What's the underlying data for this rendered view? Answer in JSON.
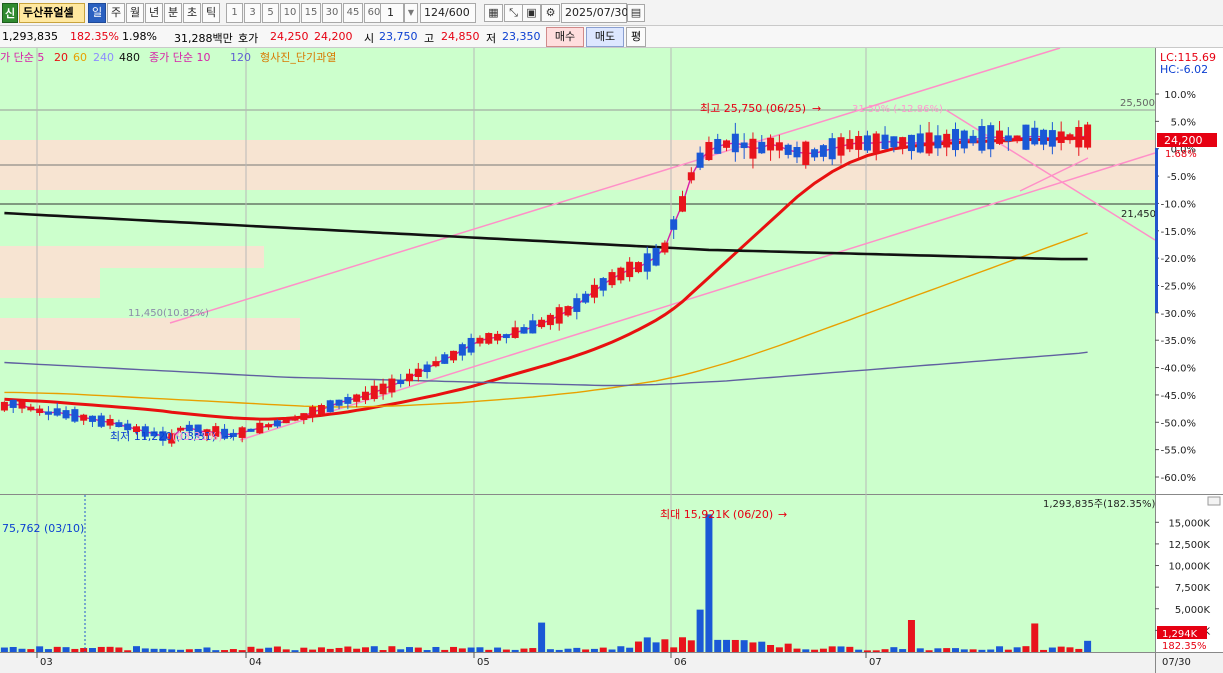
{
  "toolbar": {
    "logo_char": "신",
    "stock_name": "두산퓨얼셀",
    "periods": [
      "일",
      "주",
      "월",
      "년",
      "분",
      "초",
      "틱"
    ],
    "selected_period": "일",
    "intervals": [
      "1",
      "3",
      "5",
      "10",
      "15",
      "30",
      "45",
      "60"
    ],
    "interval_select": "1",
    "count": "124",
    "count_total": "/600",
    "date": "2025/07/30"
  },
  "info": {
    "volume": "1,293,835",
    "volume_ratio": "182.35%",
    "turnover": "1.98%",
    "amount": "31,288백만",
    "quote_label": "호가",
    "ask": "24,250",
    "bid": "24,200",
    "open_label": "시",
    "open": "23,750",
    "high_label": "고",
    "high": "24,850",
    "low_label": "저",
    "low": "23,350",
    "buy_label": "매수",
    "sell_label": "매도",
    "pyeong_label": "평"
  },
  "legend": {
    "price_ma": "가 단순 5",
    "ma20": "20",
    "ma60": "60",
    "ma240": "240",
    "ma480": "480",
    "vol_ma": "종가 단순 10",
    "vol_ma120": "120",
    "overheat": "형사진_단기과열"
  },
  "corner": {
    "lc": "LC:115.69",
    "hc": "HC:-6.02"
  },
  "annotations": {
    "high_label": "최고 25,750 (06/25)",
    "high_pct": "31.50% (-12.86%)",
    "low_label": "최저 11,220 (03/31)",
    "low_pct": "(93.31%)",
    "level_top": "25,500",
    "level_bottom": "21,450",
    "ma_note": "11,450(10.82%)",
    "current_price": "24,200",
    "current_pct": "1.68%",
    "vol_max_label": "최대 15,921K (06/20)",
    "vol_left_label": "75,762 (03/10)",
    "vol_total": "1,293,835주(182.35%)",
    "vol_current": "1,294K",
    "vol_current_pct": "182.35%"
  },
  "colors": {
    "plot_bg": "#ccffcc",
    "up": "#e8141c",
    "down": "#1a58d6",
    "ma5": "#d81fa8",
    "ma20": "#e81010",
    "ma60": "#e8a000",
    "ma240": "#6060a0",
    "ma480": "#111111",
    "trendline": "#ff8fc8",
    "zone": "#f7e4d2"
  },
  "chart_data": [
    {
      "type": "candlestick",
      "title": "",
      "x_axis_months": [
        "03",
        "04",
        "05",
        "06",
        "07"
      ],
      "x_end_label": "07/30",
      "price_axis_labels": [
        "10.0%",
        "5.0%",
        "0.0%",
        "-5.0%",
        "-10.0%",
        "-15.0%",
        "-20.0%",
        "-25.0%",
        "-30.0%",
        "-35.0%",
        "-40.0%",
        "-45.0%",
        "-50.0%",
        "-55.0%",
        "-60.0%"
      ],
      "price_high": 25750,
      "price_low": 11220,
      "last_close": 24200,
      "series": [
        {
          "name": "5",
          "values": [
            12600,
            12700,
            12650,
            12500,
            12400,
            12300,
            12350,
            12250,
            12200,
            12100,
            12050,
            11950,
            11900,
            11800,
            11700,
            11600,
            11500,
            11400,
            11300,
            11200,
            11600,
            11650,
            11550,
            11450,
            11500,
            11400,
            11350,
            11450,
            11550,
            11650,
            11750,
            11850,
            11950,
            12050,
            12150,
            12350,
            12450,
            12600,
            12750,
            12850,
            12950,
            13050,
            13200,
            13350,
            13500,
            13650,
            13850,
            14050,
            14250,
            14450,
            14650,
            14800,
            15050,
            15250,
            15450,
            15550,
            15600,
            15650,
            15800,
            15900,
            16050,
            16200,
            16350,
            16550,
            16750,
            17000,
            17300,
            17600,
            17900,
            18150,
            18350,
            18550,
            18650,
            18850,
            19100,
            19500,
            20500,
            21400,
            22600,
            23300,
            23700,
            23900,
            24000,
            24050,
            23950,
            23800,
            23850,
            24000,
            23900,
            23750,
            23650,
            23600,
            23600,
            23700,
            23800,
            23900,
            24000,
            24050,
            24050,
            24050,
            24100,
            24100,
            24050,
            24050,
            24050,
            24050,
            24100,
            24150,
            24200,
            24200,
            24200,
            24250,
            24300,
            24300,
            24250,
            24250,
            24300,
            24350,
            24300,
            24250,
            24300,
            24300,
            24300,
            24350
          ]
        },
        {
          "name": "20",
          "values": [
            12900,
            12880,
            12860,
            12840,
            12820,
            12800,
            12770,
            12740,
            12710,
            12680,
            12650,
            12620,
            12590,
            12560,
            12530,
            12500,
            12470,
            12430,
            12390,
            12340,
            12300,
            12260,
            12220,
            12180,
            12150,
            12120,
            12090,
            12070,
            12050,
            12040,
            12040,
            12050,
            12070,
            12100,
            12130,
            12160,
            12200,
            12250,
            12300,
            12350,
            12420,
            12480,
            12550,
            12620,
            12690,
            12760,
            12840,
            12920,
            13000,
            13080,
            13170,
            13260,
            13350,
            13450,
            13560,
            13670,
            13780,
            13890,
            14000,
            14110,
            14220,
            14330,
            14440,
            14560,
            14680,
            14810,
            14940,
            15080,
            15230,
            15390,
            15560,
            15740,
            15930,
            16130,
            16340,
            16580,
            16850,
            17150,
            17500,
            17850,
            18200,
            18550,
            18900,
            19250,
            19600,
            19950,
            20300,
            20650,
            21000,
            21350,
            21700,
            22000,
            22300,
            22550,
            22800,
            23000,
            23200,
            23350,
            23500,
            23600,
            23700,
            23800,
            23850,
            23900,
            23950,
            24000,
            24000,
            24050,
            24050,
            24100,
            24100,
            24100,
            24150,
            24150,
            24150,
            24200,
            24200,
            24200,
            24200,
            24200,
            24250,
            24250,
            24250,
            24250
          ]
        },
        {
          "name": "60",
          "values": [
            13200,
            13200,
            13190,
            13180,
            13170,
            13160,
            13150,
            13140,
            13120,
            13100,
            13080,
            13060,
            13040,
            13020,
            13000,
            12980,
            12960,
            12940,
            12920,
            12900,
            12880,
            12860,
            12840,
            12820,
            12800,
            12780,
            12760,
            12740,
            12720,
            12700,
            12680,
            12660,
            12640,
            12620,
            12600,
            12590,
            12580,
            12570,
            12570,
            12570,
            12570,
            12580,
            12590,
            12600,
            12610,
            12620,
            12640,
            12660,
            12680,
            12700,
            12720,
            12740,
            12760,
            12790,
            12820,
            12850,
            12880,
            12910,
            12940,
            12970,
            13000,
            13040,
            13080,
            13120,
            13160,
            13200,
            13250,
            13300,
            13350,
            13400,
            13460,
            13520,
            13580,
            13640,
            13700,
            13780,
            13860,
            13950,
            14050,
            14150,
            14260,
            14370,
            14480,
            14600,
            14720,
            14850,
            14980,
            15110,
            15240,
            15380,
            15520,
            15660,
            15800,
            15940,
            16080,
            16220,
            16360,
            16500,
            16640,
            16780,
            16920,
            17060,
            17200,
            17340,
            17480,
            17620,
            17760,
            17900,
            18040,
            18180,
            18320,
            18460,
            18600,
            18740,
            18880,
            19020,
            19160,
            19300,
            19440,
            19580,
            19720,
            19860,
            20000,
            20140
          ]
        },
        {
          "name": "240",
          "values": [
            14500,
            14480,
            14460,
            14440,
            14420,
            14400,
            14380,
            14360,
            14340,
            14320,
            14300,
            14280,
            14260,
            14240,
            14220,
            14200,
            14180,
            14160,
            14140,
            14120,
            14100,
            14080,
            14060,
            14040,
            14020,
            14000,
            13980,
            13960,
            13940,
            13920,
            13900,
            13880,
            13860,
            13850,
            13840,
            13830,
            13820,
            13810,
            13800,
            13790,
            13780,
            13770,
            13760,
            13750,
            13740,
            13730,
            13720,
            13710,
            13700,
            13690,
            13680,
            13670,
            13660,
            13650,
            13640,
            13630,
            13620,
            13610,
            13600,
            13590,
            13580,
            13570,
            13560,
            13550,
            13540,
            13530,
            13520,
            13510,
            13500,
            13500,
            13500,
            13510,
            13520,
            13530,
            13540,
            13560,
            13580,
            13600,
            13620,
            13640,
            13660,
            13680,
            13700,
            13730,
            13760,
            13790,
            13820,
            13850,
            13880,
            13910,
            13940,
            13970,
            14000,
            14030,
            14060,
            14090,
            14120,
            14150,
            14180,
            14210,
            14240,
            14270,
            14300,
            14330,
            14360,
            14390,
            14420,
            14450,
            14480,
            14510,
            14540,
            14570,
            14600,
            14630,
            14660,
            14690,
            14720,
            14750,
            14780,
            14810,
            14840,
            14870,
            14900,
            14950
          ]
        },
        {
          "name": "480",
          "values": [
            21000,
            20980,
            20960,
            20940,
            20920,
            20900,
            20880,
            20860,
            20840,
            20820,
            20800,
            20780,
            20760,
            20740,
            20720,
            20700,
            20680,
            20660,
            20640,
            20620,
            20600,
            20580,
            20560,
            20540,
            20520,
            20500,
            20480,
            20460,
            20440,
            20420,
            20400,
            20380,
            20360,
            20340,
            20320,
            20300,
            20280,
            20260,
            20240,
            20220,
            20200,
            20180,
            20160,
            20140,
            20120,
            20100,
            20080,
            20060,
            20040,
            20020,
            20000,
            19980,
            19960,
            19940,
            19920,
            19900,
            19880,
            19860,
            19840,
            19820,
            19800,
            19780,
            19760,
            19740,
            19720,
            19700,
            19680,
            19660,
            19640,
            19620,
            19600,
            19580,
            19560,
            19540,
            19520,
            19500,
            19480,
            19460,
            19440,
            19420,
            19400,
            19390,
            19380,
            19370,
            19360,
            19350,
            19340,
            19330,
            19320,
            19310,
            19300,
            19290,
            19280,
            19270,
            19260,
            19250,
            19240,
            19230,
            19220,
            19210,
            19200,
            19190,
            19180,
            19170,
            19160,
            19150,
            19140,
            19130,
            19120,
            19110,
            19100,
            19090,
            19080,
            19070,
            19060,
            19050,
            19040,
            19030,
            19020,
            19010,
            19000,
            19000,
            19000,
            19000
          ]
        }
      ]
    },
    {
      "type": "bar",
      "title": "",
      "x_axis_months": [
        "03",
        "04",
        "05",
        "06",
        "07"
      ],
      "y_axis_labels": [
        "15,000K",
        "12,500K",
        "10,000K",
        "7,500K",
        "5,000K",
        "2,500K"
      ],
      "ylim": [
        0,
        17000
      ],
      "max_value_k": 15921,
      "current_value_k": 1294
    }
  ]
}
